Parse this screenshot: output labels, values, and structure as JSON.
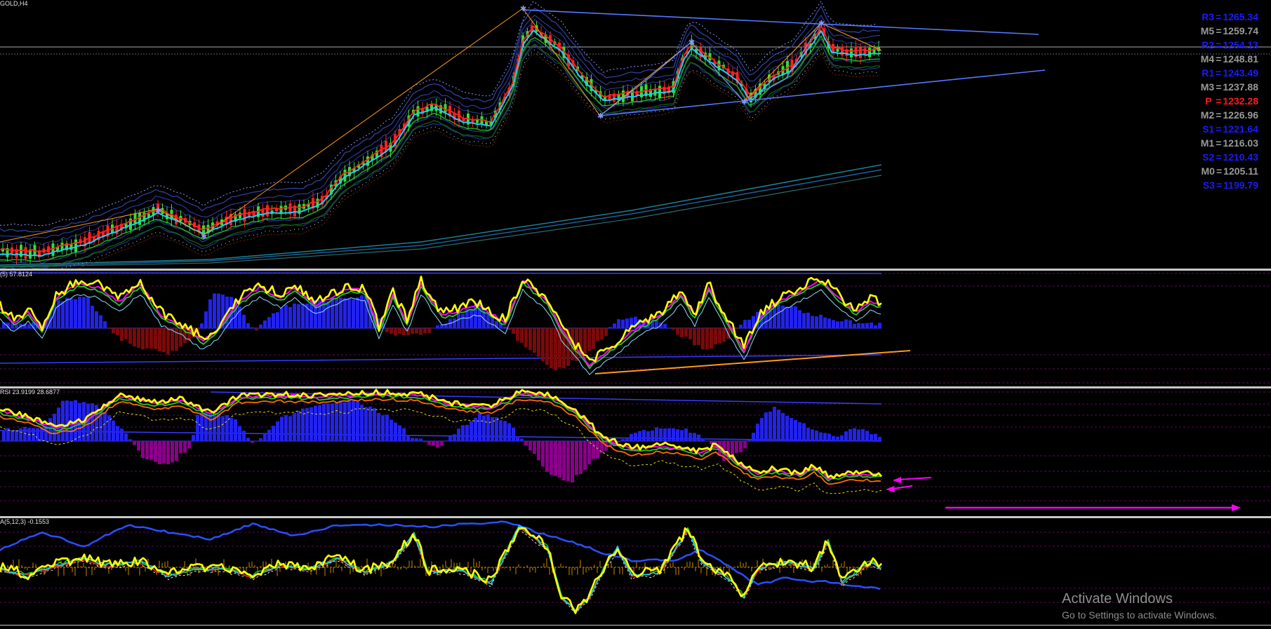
{
  "symbol_label": "GOLD,H4",
  "panes": {
    "p1": {
      "label": "(5) 57.8124"
    },
    "p2": {
      "label": "RSI 23.9199 28.6877"
    },
    "p3": {
      "label": "A(5,12,3) -0.1553"
    }
  },
  "pivots": [
    {
      "name": "R3",
      "value": "1265.34",
      "color": "#1a1aff"
    },
    {
      "name": "M5",
      "value": "1259.74",
      "color": "#9a9a9a"
    },
    {
      "name": "R2",
      "value": "1254.13",
      "color": "#1a1aff"
    },
    {
      "name": "M4",
      "value": "1248.81",
      "color": "#9a9a9a"
    },
    {
      "name": "R1",
      "value": "1243.49",
      "color": "#1a1aff"
    },
    {
      "name": "M3",
      "value": "1237.88",
      "color": "#9a9a9a"
    },
    {
      "name": "P ",
      "value": "1232.28",
      "color": "#ff1a1a"
    },
    {
      "name": "M2",
      "value": "1226.96",
      "color": "#9a9a9a"
    },
    {
      "name": "S1",
      "value": "1221.64",
      "color": "#1a1aff"
    },
    {
      "name": "M1",
      "value": "1216.03",
      "color": "#9a9a9a"
    },
    {
      "name": "S2",
      "value": "1210.43",
      "color": "#1a1aff"
    },
    {
      "name": "M0",
      "value": "1205.11",
      "color": "#9a9a9a"
    },
    {
      "name": "S3",
      "value": "1199.79",
      "color": "#1a1aff"
    }
  ],
  "watermark": {
    "title": "Activate Windows",
    "subtitle": "Go to Settings to activate Windows."
  },
  "colors": {
    "bull": "#33dd33",
    "bear": "#ff2222",
    "blue_hist": "#2222ee",
    "red_hist": "#7a0a0a",
    "purple_hist": "#8a008a",
    "yellow": "#ffff00",
    "magenta": "#ff00ff",
    "trendline": "#5577ff",
    "orange": "#ff9a1a"
  }
}
